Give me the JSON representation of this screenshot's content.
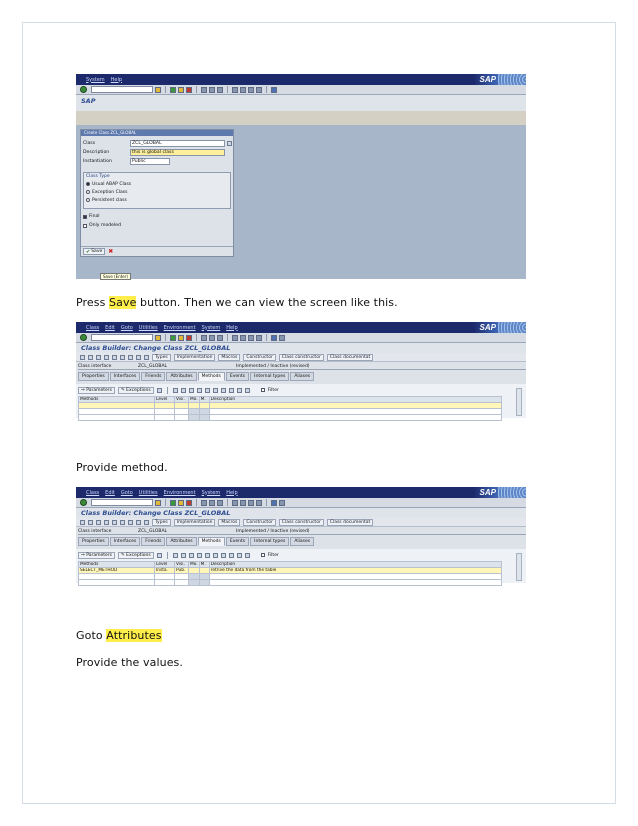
{
  "para": {
    "press_pre": "Press ",
    "press_hl": "Save",
    "press_post": " button. Then we can view the screen like this.",
    "provide_method": "Provide method.",
    "goto_pre": "Goto ",
    "goto_hl": "Attributes",
    "provide_values": "Provide the values."
  },
  "shot1": {
    "menu": [
      "System",
      "Help"
    ],
    "title": "SAP",
    "dialog_title": "Create Class ZCL_GLOBAL",
    "fields": [
      {
        "label": "Class",
        "value": "ZCL_GLOBAL"
      },
      {
        "label": "Description",
        "value": "this is global class"
      },
      {
        "label": "Instantiation",
        "value": "Public"
      }
    ],
    "class_type_title": "Class Type",
    "class_types": [
      "Usual ABAP Class",
      "Exception Class",
      "Persistent class"
    ],
    "checks": [
      "Final",
      "Only modeled"
    ],
    "save_label": "Save",
    "tooltip": "Save (Enter)"
  },
  "builder": {
    "menu": [
      "Class",
      "Edit",
      "Goto",
      "Utilities",
      "Environment",
      "System",
      "Help"
    ],
    "title": "Class Builder: Change Class ZCL_GLOBAL",
    "appbar": [
      "Types",
      "Implementation",
      "Macros",
      "Constructor",
      "Class constructor",
      "Class documentat"
    ],
    "interface_label": "Class interface",
    "interface_value": "ZCL_GLOBAL",
    "status": "Implemented / Inactive (revised)",
    "tabs": [
      "Properties",
      "Interfaces",
      "Friends",
      "Attributes",
      "Methods",
      "Events",
      "Internal types",
      "Aliases"
    ],
    "sub_buttons": [
      "Parameters",
      "Exceptions"
    ],
    "filter": "Filter",
    "columns": [
      "Methods",
      "Level",
      "Visi.",
      "Mo.",
      "M.",
      "Description"
    ]
  },
  "shot3_row": {
    "method": "SELECT_METHOD",
    "level": "Insta.",
    "visi": "Pub.",
    "description": "retrive the data from the table"
  }
}
